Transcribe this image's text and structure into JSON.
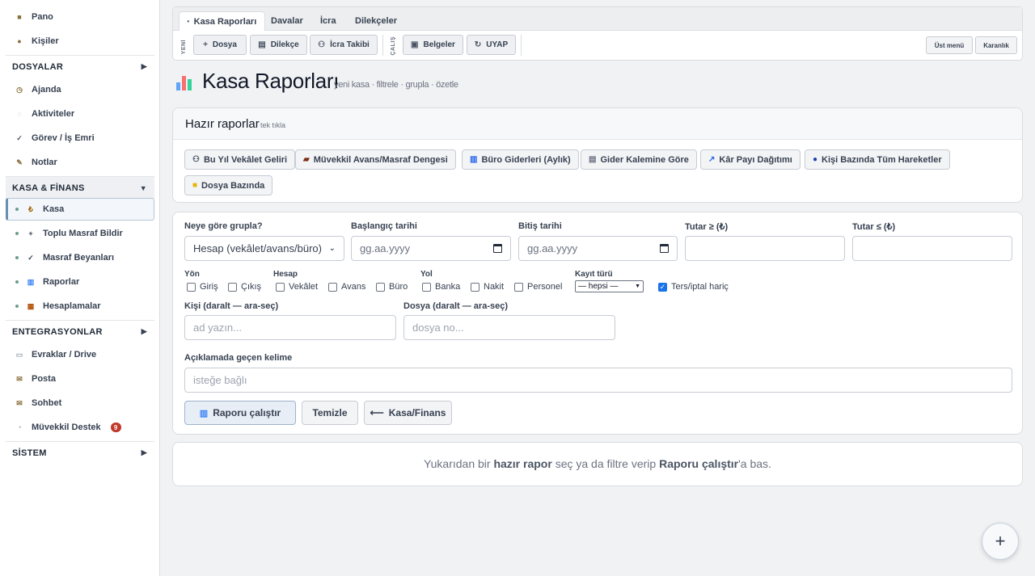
{
  "sidebar": {
    "top_items": [
      {
        "label": "Pano",
        "icon": "dashboard-icon"
      },
      {
        "label": "Kişiler",
        "icon": "people-icon"
      }
    ],
    "sections": {
      "dosyalar": "DOSYALAR",
      "kasa_finans": "KASA & FİNANS",
      "entegrasyonlar": "ENTEGRASYONLAR",
      "sistem": "SİSTEM"
    },
    "dosyalar_items": [
      {
        "label": "Ajanda",
        "icon": "clock-icon"
      },
      {
        "label": "Aktiviteler",
        "icon": "activity-icon"
      },
      {
        "label": "Görev / İş Emri",
        "icon": "check-icon"
      },
      {
        "label": "Notlar",
        "icon": "pencil-icon"
      }
    ],
    "kasa_items": [
      {
        "label": "Kasa",
        "icon": "lira-icon",
        "glyph": "₺"
      },
      {
        "label": "Toplu Masraf Bildir",
        "icon": "plus-icon",
        "glyph": "+"
      },
      {
        "label": "Masraf Beyanları",
        "icon": "check-icon",
        "glyph": "✓"
      },
      {
        "label": "Raporlar",
        "icon": "bar-chart-icon",
        "glyph": "▥"
      },
      {
        "label": "Hesaplamalar",
        "icon": "calculator-icon",
        "glyph": "▦"
      }
    ],
    "entegrasyon_items": [
      {
        "label": "Evraklar / Drive",
        "icon": "folder-icon"
      },
      {
        "label": "Posta",
        "icon": "mail-icon"
      },
      {
        "label": "Sohbet",
        "icon": "chat-icon"
      },
      {
        "label": "Müvekkil Destek",
        "icon": "support-icon",
        "badge": "9"
      }
    ]
  },
  "topbar": {
    "tabs": [
      "Kasa Raporları",
      "Davalar",
      "İcra",
      "Dilekçeler"
    ],
    "yeni_label": "YENİ",
    "calis_label": "ÇALIŞ",
    "buttons": {
      "dosya": "Dosya",
      "dilekce": "Dilekçe",
      "icra_takibi": "İcra Takibi",
      "belgeler": "Belgeler",
      "uyap": "UYAP",
      "ust_menu": "Üst menü",
      "karanlik": "Karanlık"
    }
  },
  "page": {
    "title": "Kasa Raporları",
    "subtitle": "yeni kasa · filtrele · grupla · özetle"
  },
  "ready_reports": {
    "title": "Hazır raporlar",
    "hint": "tek tıkla",
    "buttons": [
      "Bu Yıl Vekâlet Geliri",
      "Müvekkil Avans/Masraf Dengesi",
      "Büro Giderleri (Aylık)",
      "Gider Kalemine Göre",
      "Kâr Payı Dağıtımı",
      "Kişi Bazında Tüm Hareketler",
      "Dosya Bazında"
    ]
  },
  "filters": {
    "group_label": "Neye göre grupla?",
    "group_value": "Hesap (vekâlet/avans/büro)",
    "start_label": "Başlangıç tarihi",
    "start_placeholder": "gg.aa.yyyy",
    "end_label": "Bitiş tarihi",
    "end_placeholder": "gg.aa.yyyy",
    "min_label": "Tutar ≥ (₺)",
    "max_label": "Tutar ≤ (₺)",
    "yon_label": "Yön",
    "yon_options": [
      "Giriş",
      "Çıkış"
    ],
    "hesap_label": "Hesap",
    "hesap_options": [
      "Vekâlet",
      "Avans",
      "Büro"
    ],
    "yol_label": "Yol",
    "yol_options": [
      "Banka",
      "Nakit",
      "Personel"
    ],
    "kayit_label": "Kayıt türü",
    "kayit_value": "— hepsi —",
    "ters_label": "Ters/iptal hariç",
    "kisi_label": "Kişi (daralt — ara-seç)",
    "kisi_placeholder": "ad yazın...",
    "dosya_label": "Dosya (daralt — ara-seç)",
    "dosya_placeholder": "dosya no...",
    "aciklama_label": "Açıklamada geçen kelime",
    "aciklama_placeholder": "isteğe bağlı",
    "run_button": "Raporu çalıştır",
    "clear_button": "Temizle",
    "back_button": "Kasa/Finans"
  },
  "result": {
    "t1": "Yukarıdan bir",
    "t2": "hazır rapor",
    "t3": "seç ya da filtre verip",
    "t4": "Raporu çalıştır",
    "t5": "'a bas."
  },
  "fab_label": "+"
}
